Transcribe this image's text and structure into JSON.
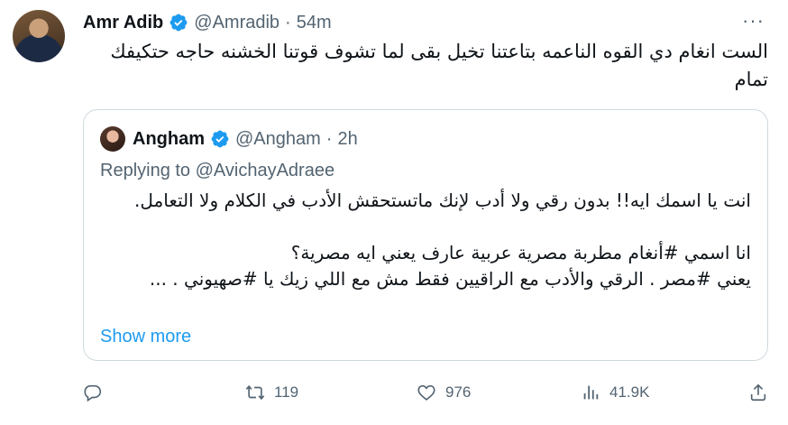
{
  "author": {
    "name": "Amr Adib",
    "handle": "@Amradib",
    "separator": "·",
    "time": "54m"
  },
  "tweet": {
    "text": "الست انغام دي القوه الناعمه بتاعتنا تخيل بقى لما تشوف قوتنا الخشنه حاجه حتكيفك تمام"
  },
  "quote": {
    "name": "Angham",
    "handle": "@Angham",
    "separator": "·",
    "time": "2h",
    "replying_prefix": "Replying to ",
    "replying_to": "@AvichayAdraee",
    "text": "انت يا اسمك ايه!! بدون رقي ولا أدب لإنك ماتستحقش الأدب في الكلام ولا التعامل.\n\nانا اسمي #أنغام مطربة مصرية عربية عارف يعني ايه مصرية؟\nيعني #مصر . الرقي والأدب مع الراقيين فقط مش مع اللي زيك يا #صهيوني . ...",
    "show_more": "Show more"
  },
  "actions": {
    "replies": "",
    "retweets": "119",
    "likes": "976",
    "views": "41.9K"
  },
  "icons": {
    "verified": "verified-badge-icon",
    "more": "more-horizontal-icon",
    "reply": "reply-icon",
    "retweet": "retweet-icon",
    "like": "heart-icon",
    "views": "views-icon",
    "share": "share-icon"
  },
  "colors": {
    "verified": "#1d9bf0",
    "link": "#1d9bf0",
    "muted": "#536471",
    "border": "#cfd9de"
  }
}
